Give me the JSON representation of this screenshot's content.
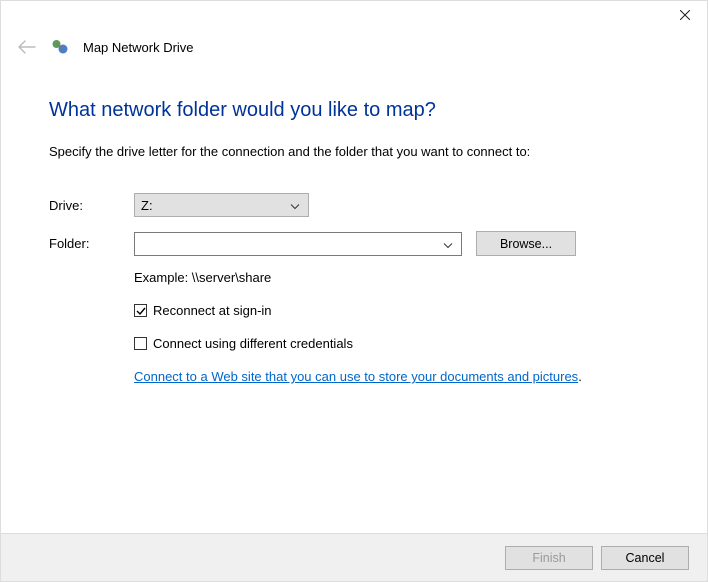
{
  "window": {
    "title": "Map Network Drive"
  },
  "content": {
    "heading": "What network folder would you like to map?",
    "instruction": "Specify the drive letter for the connection and the folder that you want to connect to:",
    "drive_label": "Drive:",
    "drive_value": "Z:",
    "folder_label": "Folder:",
    "folder_value": "",
    "browse_label": "Browse...",
    "example": "Example: \\\\server\\share",
    "reconnect_label": "Reconnect at sign-in",
    "reconnect_checked": true,
    "diffcreds_label": "Connect using different credentials",
    "diffcreds_checked": false,
    "link_text": "Connect to a Web site that you can use to store your documents and pictures"
  },
  "footer": {
    "finish": "Finish",
    "cancel": "Cancel"
  }
}
